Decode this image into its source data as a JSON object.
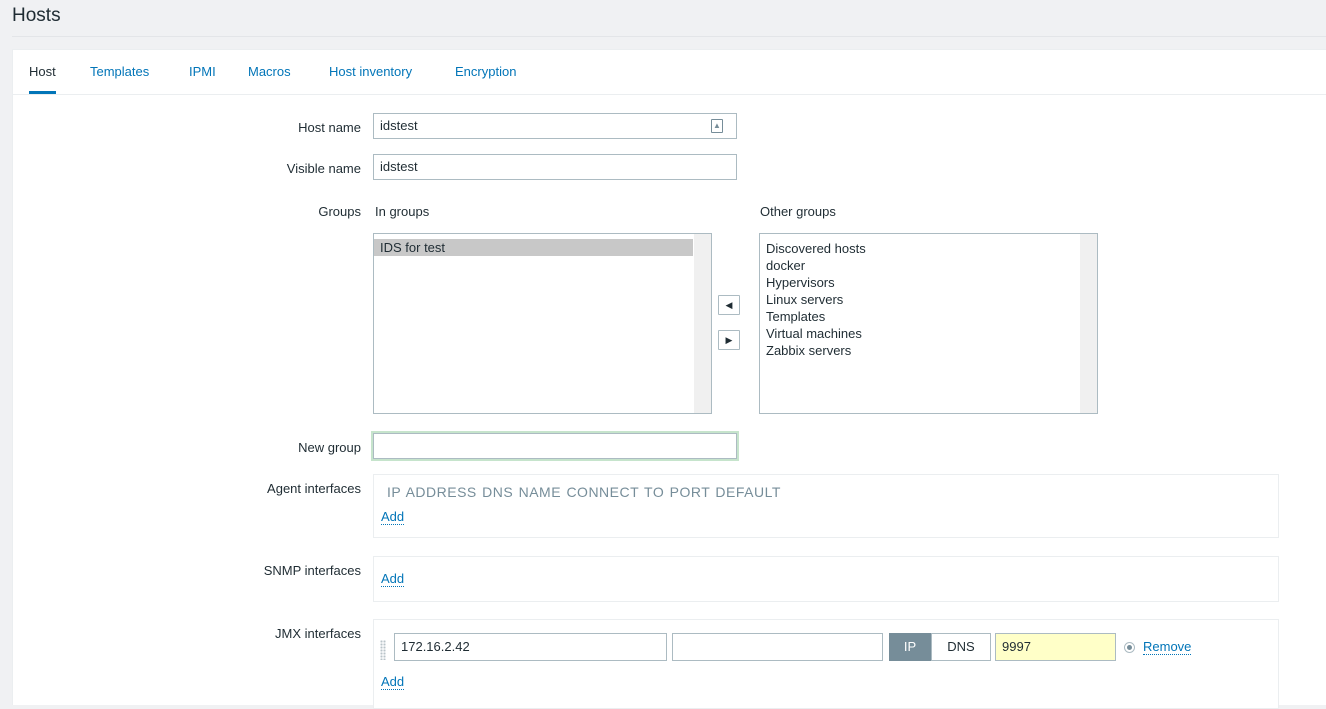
{
  "page": {
    "title": "Hosts"
  },
  "tabs": [
    {
      "label": "Host",
      "active": true
    },
    {
      "label": "Templates"
    },
    {
      "label": "IPMI"
    },
    {
      "label": "Macros"
    },
    {
      "label": "Host inventory"
    },
    {
      "label": "Encryption"
    }
  ],
  "form": {
    "host_name": {
      "label": "Host name",
      "value": "idstest"
    },
    "visible_name": {
      "label": "Visible name",
      "value": "idstest"
    },
    "groups": {
      "label": "Groups",
      "in_groups_label": "In groups",
      "other_groups_label": "Other groups",
      "in_groups": [
        "IDS for test"
      ],
      "other_groups": [
        "Discovered hosts",
        "docker",
        "Hypervisors",
        "Linux servers",
        "Templates",
        "Virtual machines",
        "Zabbix servers"
      ]
    },
    "new_group": {
      "label": "New group",
      "value": ""
    },
    "agent_interfaces": {
      "label": "Agent interfaces",
      "header": "IP ADDRESS DNS NAME CONNECT TO PORT DEFAULT",
      "add": "Add"
    },
    "snmp_interfaces": {
      "label": "SNMP interfaces",
      "add": "Add"
    },
    "jmx_interfaces": {
      "label": "JMX interfaces",
      "ip": "172.16.2.42",
      "dns": "",
      "connect_ip": "IP",
      "connect_dns": "DNS",
      "port": "9997",
      "remove": "Remove",
      "add": "Add"
    }
  },
  "colors": {
    "accent": "#0275b8",
    "selected_segment": "#768d99",
    "port_bg": "#ffffc8",
    "focus_glow": "#c6e4cc"
  }
}
